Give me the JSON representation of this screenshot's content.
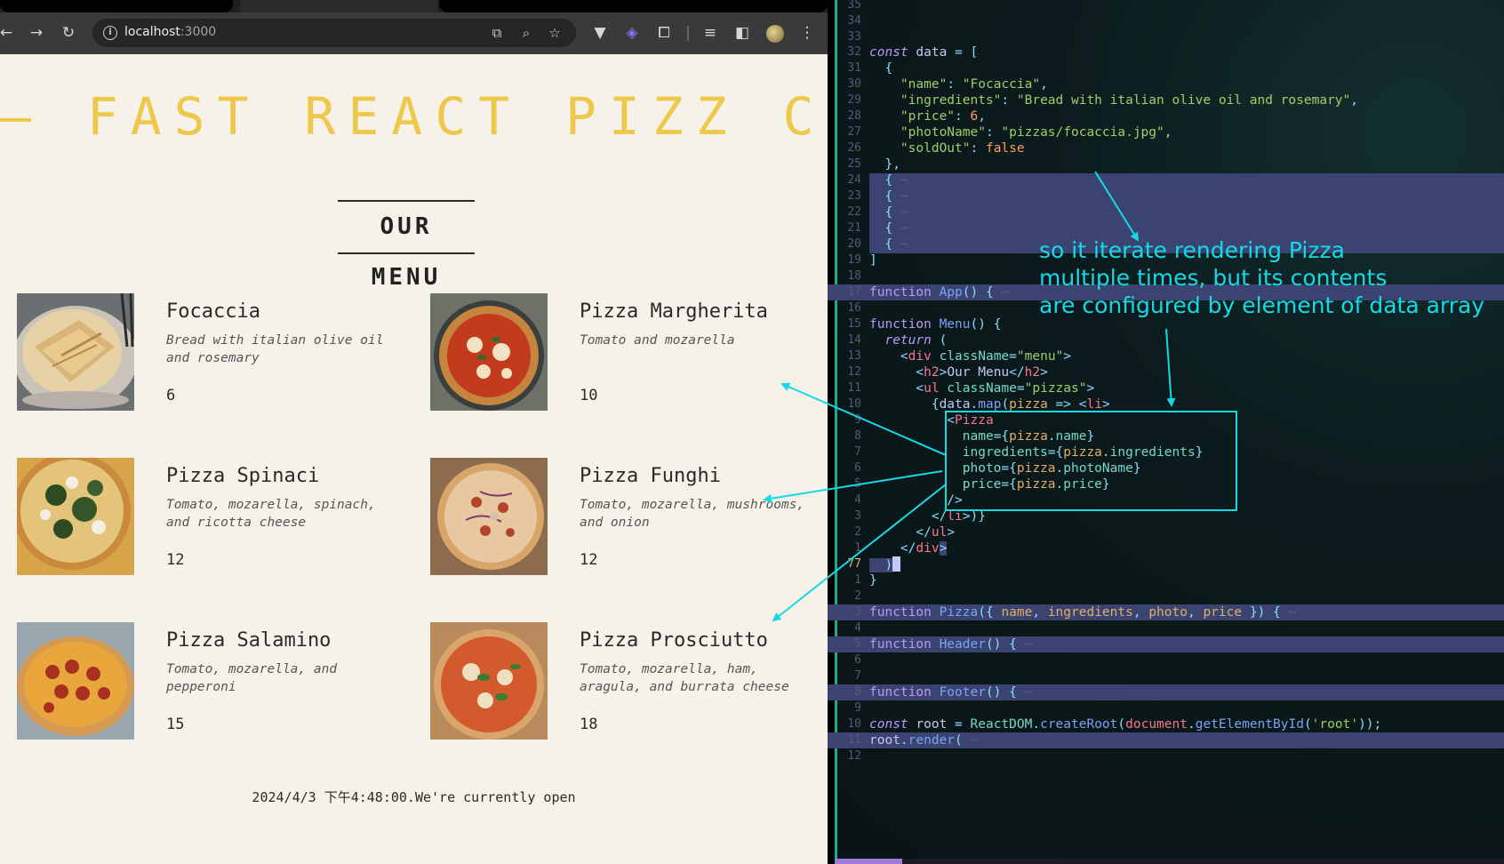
{
  "browser": {
    "url_host": "localhost",
    "url_port": ":3000",
    "icons": {
      "back": "arrow-left-icon",
      "forward": "arrow-right-icon",
      "reload": "reload-icon",
      "info": "info-icon",
      "install": "install-app-icon",
      "zoom": "zoom-icon",
      "bookmark": "star-icon",
      "menu": "kebab-menu-icon"
    }
  },
  "app": {
    "title": "— FAST REACT PIZZ CO. —",
    "menu_heading": "OUR MENU",
    "pizzas": [
      {
        "name": "Focaccia",
        "ingredients": "Bread with italian olive oil and rosemary",
        "price": "6"
      },
      {
        "name": "Pizza Margherita",
        "ingredients": "Tomato and mozarella",
        "price": "10"
      },
      {
        "name": "Pizza Spinaci",
        "ingredients": "Tomato, mozarella, spinach, and ricotta cheese",
        "price": "12"
      },
      {
        "name": "Pizza Funghi",
        "ingredients": "Tomato, mozarella, mushrooms, and onion",
        "price": "12"
      },
      {
        "name": "Pizza Salamino",
        "ingredients": "Tomato, mozarella, and pepperoni",
        "price": "15"
      },
      {
        "name": "Pizza Prosciutto",
        "ingredients": "Tomato, mozarella, ham, aragula, and burrata cheese",
        "price": "18"
      }
    ],
    "footer": "2024/4/3 下午4:48:00.We're currently open"
  },
  "editor": {
    "line_numbers": [
      "35",
      "34",
      "33",
      "32",
      "31",
      "30",
      "29",
      "28",
      "27",
      "26",
      "25",
      "24",
      "23",
      "22",
      "21",
      "20",
      "19",
      "18",
      "17",
      "16",
      "15",
      "14",
      "13",
      "12",
      "11",
      "10",
      "9",
      "8",
      "7",
      "6",
      "5",
      "4",
      "3",
      "2",
      "1",
      "77",
      "1",
      "2",
      "3",
      "4",
      "5",
      "6",
      "7",
      "8",
      "9",
      "10",
      "11",
      "12"
    ]
  },
  "annotation": {
    "text": "so it iterate rendering Pizza\nmultiple times, but its contents\nare configured by element of data array",
    "color": "#16d9e6"
  },
  "colors": {
    "title_yellow": "#edc84b",
    "page_bg": "#f7f2e9",
    "editor_fold": "#3b4471"
  }
}
